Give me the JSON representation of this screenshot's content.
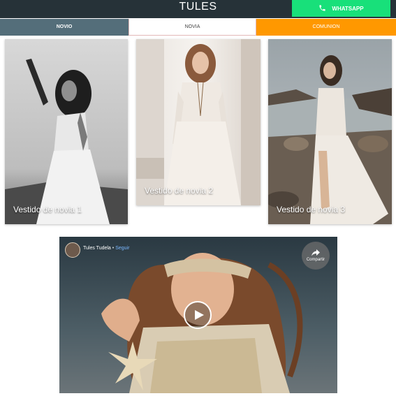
{
  "header": {
    "title": "TULES",
    "whatsapp_label": "WHATSAPP"
  },
  "tabs": [
    {
      "label": "NOVIO"
    },
    {
      "label": "NOVIA"
    },
    {
      "label": "COMUNION"
    }
  ],
  "cards": [
    {
      "caption": "Vestido de novia 1"
    },
    {
      "caption": "Vestido de novia 2"
    },
    {
      "caption": "Vestido de novia 3"
    }
  ],
  "video": {
    "channel": "Tules Tudela",
    "separator": "•",
    "follow_label": "Seguir",
    "share_label": "Compartir"
  },
  "colors": {
    "topbar": "#263238",
    "whatsapp": "#18e07a",
    "tab_novio": "#546e7a",
    "tab_comunion": "#ff9800"
  }
}
